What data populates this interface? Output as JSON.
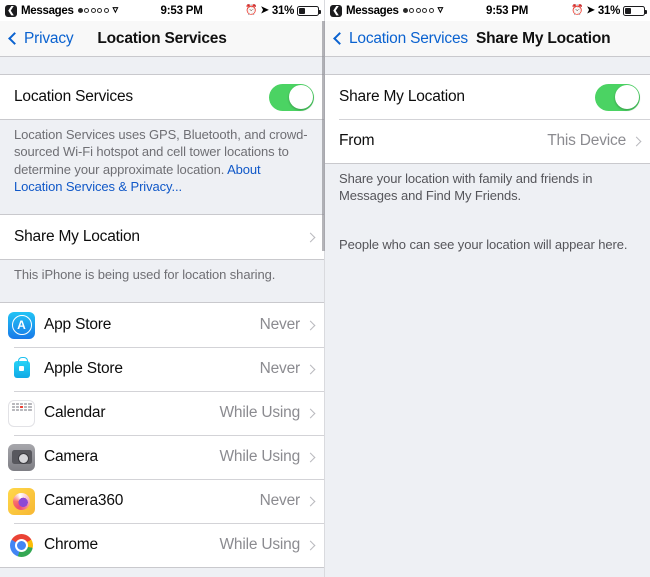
{
  "left_screen": {
    "status_bar": {
      "back_chip_icon": "back-arrow-icon",
      "carrier": "Messages",
      "signal_dots_total": 5,
      "signal_dots_filled": 1,
      "wifi_icon": "wifi-icon",
      "time": "9:53 PM",
      "alarm_icon": "alarm-icon",
      "location_icon": "location-arrow-icon",
      "battery_percent": "31%",
      "battery_icon": "battery-icon"
    },
    "nav": {
      "back_label": "Privacy",
      "back_icon": "chevron-left-icon",
      "title": "Location Services"
    },
    "master_switch": {
      "label": "Location Services",
      "toggle_on": true
    },
    "description": {
      "text": "Location Services uses GPS, Bluetooth, and crowd-sourced Wi-Fi hotspot and cell tower locations to determine your approximate location. ",
      "link": "About Location Services & Privacy..."
    },
    "share_row": {
      "label": "Share My Location",
      "chevron_icon": "chevron-right-icon"
    },
    "share_note": "This iPhone is being used for location sharing.",
    "apps": [
      {
        "name": "App Store",
        "value": "Never",
        "icon": "app-store-icon",
        "chevron_icon": "chevron-right-icon"
      },
      {
        "name": "Apple Store",
        "value": "Never",
        "icon": "apple-store-icon",
        "chevron_icon": "chevron-right-icon"
      },
      {
        "name": "Calendar",
        "value": "While Using",
        "icon": "calendar-icon",
        "chevron_icon": "chevron-right-icon"
      },
      {
        "name": "Camera",
        "value": "While Using",
        "icon": "camera-icon",
        "chevron_icon": "chevron-right-icon"
      },
      {
        "name": "Camera360",
        "value": "Never",
        "icon": "camera360-icon",
        "chevron_icon": "chevron-right-icon"
      },
      {
        "name": "Chrome",
        "value": "While Using",
        "icon": "chrome-icon",
        "chevron_icon": "chevron-right-icon"
      }
    ]
  },
  "right_screen": {
    "status_bar": {
      "back_chip_icon": "back-arrow-icon",
      "carrier": "Messages",
      "signal_dots_total": 5,
      "signal_dots_filled": 1,
      "wifi_icon": "wifi-icon",
      "time": "9:53 PM",
      "alarm_icon": "alarm-icon",
      "location_icon": "location-arrow-icon",
      "battery_percent": "31%",
      "battery_icon": "battery-icon"
    },
    "nav": {
      "back_label": "Location Services",
      "back_icon": "chevron-left-icon",
      "title": "Share My Location"
    },
    "share_switch": {
      "label": "Share My Location",
      "toggle_on": true
    },
    "from_row": {
      "label": "From",
      "value": "This Device",
      "chevron_icon": "chevron-right-icon"
    },
    "description": "Share your location with family and friends in Messages and Find My Friends.",
    "people_note": "People who can see your location will appear here."
  },
  "colors": {
    "toggle_on": "#4bd363",
    "link": "#1058c8",
    "nav_tint": "#0a62d0",
    "page_bg": "#eef0f4",
    "row_bg": "#ffffff",
    "secondary_text": "#8b8b90"
  }
}
